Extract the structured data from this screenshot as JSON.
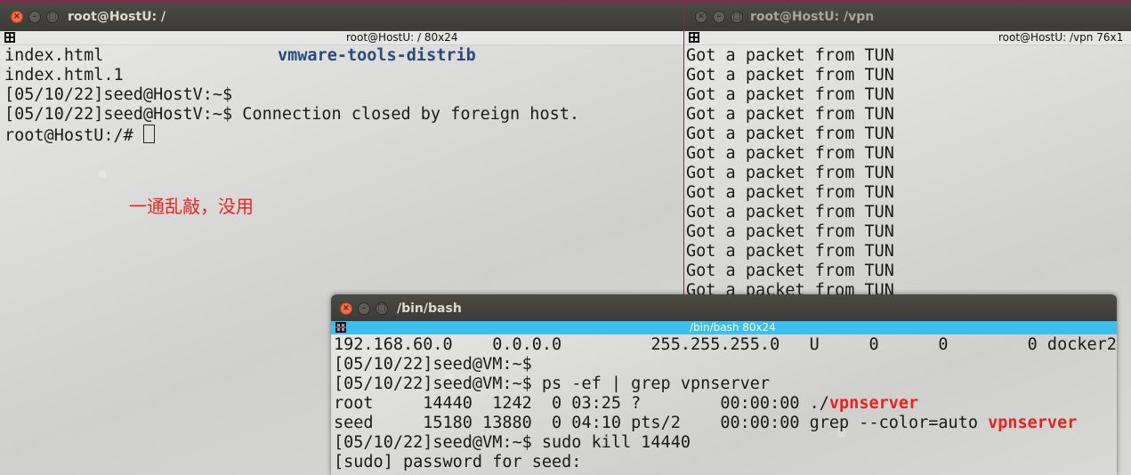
{
  "win_left": {
    "title": "root@HostU: /",
    "tab": "root@HostU: / 80x24",
    "lines": [
      "index.html",
      "index.html.1",
      "[05/10/22]seed@HostV:~$",
      "[05/10/22]seed@HostV:~$ Connection closed by foreign host.",
      "root@HostU:/# "
    ],
    "dir_item": "vmware-tools-distrib",
    "annotation": "一通乱敲，没用"
  },
  "win_right": {
    "title": "root@HostU: /vpn",
    "tab": "root@HostU: /vpn 76x1",
    "lines": [
      "Got a packet from TUN",
      "Got a packet from TUN",
      "Got a packet from TUN",
      "Got a packet from TUN",
      "Got a packet from TUN",
      "Got a packet from TUN",
      "Got a packet from TUN",
      "Got a packet from TUN",
      "Got a packet from TUN",
      "Got a packet from TUN",
      "Got a packet from TUN",
      "Got a packet from TUN",
      "Got a packet from TUN"
    ]
  },
  "win_bash": {
    "title": "/bin/bash",
    "tab": "/bin/bash 80x24",
    "line0": "192.168.60.0    0.0.0.0         255.255.255.0   U     0      0        0 docker2",
    "line1": "[05/10/22]seed@VM:~$",
    "line2": "[05/10/22]seed@VM:~$ ps -ef | grep vpnserver",
    "line3_pre": "root     14440  1242  0 03:25 ?        00:00:00 ./",
    "line3_hl": "vpnserver",
    "line4_pre": "seed     15180 13880  0 04:10 pts/2    00:00:00 grep --color=auto ",
    "line4_hl": "vpnserver",
    "line5": "[05/10/22]seed@VM:~$ sudo kill 14440",
    "line6": "[sudo] password for seed:"
  },
  "colors": {
    "annotation": "#e8231f",
    "highlight": "#e8231f",
    "active_tab": "#3bbfee",
    "title_bar": "#3c3b37",
    "close_button": "#f26d4a"
  }
}
